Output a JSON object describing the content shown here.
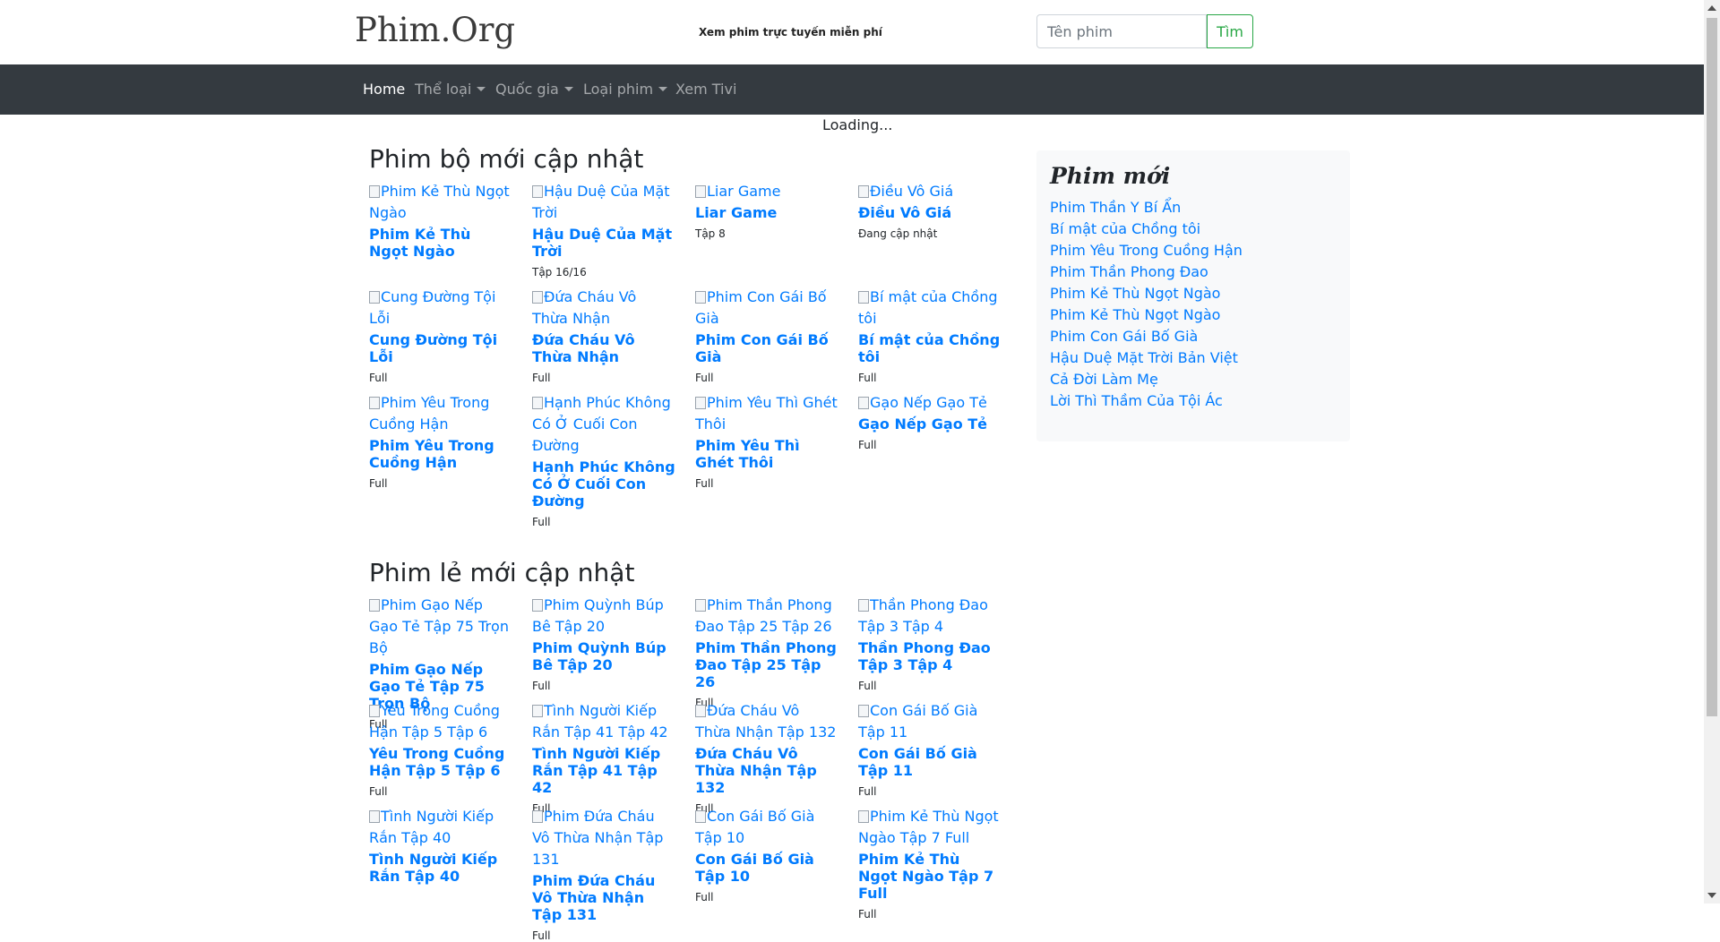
{
  "header": {
    "logo": "Phim.Org",
    "tagline": "Xem phim trực tuyến miễn phí",
    "search_placeholder": "Tên phim",
    "search_button": "Tìm"
  },
  "nav": {
    "home": "Home",
    "genres": "Thể loại",
    "countries": "Quốc gia",
    "types": "Loại phim",
    "tv": "Xem Tivi"
  },
  "loading": "Loading...",
  "series_section": {
    "title": "Phim bộ mới cập nhật",
    "items": [
      {
        "alt": "Phim Kẻ Thù Ngọt Ngào",
        "title": "Phim Kẻ Thù Ngọt Ngào",
        "status": ""
      },
      {
        "alt": "Hậu Duệ Của Mặt Trời",
        "title": "Hậu Duệ Của Mặt Trời",
        "status": "Tập 16/16"
      },
      {
        "alt": "Liar Game",
        "title": "Liar Game",
        "status": "Tập 8"
      },
      {
        "alt": "Điều Vô Giá",
        "title": "Điều Vô Giá",
        "status": "Đang cập nhật"
      },
      {
        "alt": "Cung Đường Tội Lỗi",
        "title": "Cung Đường Tội Lỗi",
        "status": "Full"
      },
      {
        "alt": "Đứa Cháu Vô Thừa Nhận",
        "title": "Đứa Cháu Vô Thừa Nhận",
        "status": "Full"
      },
      {
        "alt": "Phim Con Gái Bố Già",
        "title": "Phim Con Gái Bố Già",
        "status": "Full"
      },
      {
        "alt": "Bí mật của Chồng tôi",
        "title": "Bí mật của Chồng tôi",
        "status": "Full"
      },
      {
        "alt": "Phim Yêu Trong Cuồng Hận",
        "title": "Phim Yêu Trong Cuồng Hận",
        "status": "Full"
      },
      {
        "alt": "Hạnh Phúc Không Có Ở Cuối Con Đường",
        "title": "Hạnh Phúc Không Có Ở Cuối Con Đường",
        "status": "Full"
      },
      {
        "alt": "Phim Yêu Thì Ghét Thôi",
        "title": "Phim Yêu Thì Ghét Thôi",
        "status": "Full"
      },
      {
        "alt": "Gạo Nếp Gạo Tẻ",
        "title": "Gạo Nếp Gạo Tẻ",
        "status": "Full"
      }
    ]
  },
  "movies_section": {
    "title": "Phim lẻ mới cập nhật",
    "items": [
      {
        "alt": "Phim Gạo Nếp Gạo Tẻ Tập 75 Trọn Bộ",
        "title": "Phim Gạo Nếp Gạo Tẻ Tập 75 Trọn Bộ",
        "status": "Full"
      },
      {
        "alt": "Phim Quỳnh Búp Bê Tập 20",
        "title": "Phim Quỳnh Búp Bê Tập 20",
        "status": "Full"
      },
      {
        "alt": "Phim Thần Phong Đao Tập 25 Tập 26",
        "title": "Phim Thần Phong Đao Tập 25 Tập 26",
        "status": "Full"
      },
      {
        "alt": "Thần Phong Đao Tập 3 Tập 4",
        "title": "Thần Phong Đao Tập 3 Tập 4",
        "status": "Full"
      },
      {
        "alt": "Yêu Trong Cuồng Hận Tập 5 Tập 6",
        "title": "Yêu Trong Cuồng Hận Tập 5 Tập 6",
        "status": "Full"
      },
      {
        "alt": "Tình Người Kiếp Rắn Tập 41 Tập 42",
        "title": "Tình Người Kiếp Rắn Tập 41 Tập 42",
        "status": "Full"
      },
      {
        "alt": "Đứa Cháu Vô Thừa Nhận Tập 132",
        "title": "Đứa Cháu Vô Thừa Nhận Tập 132",
        "status": "Full"
      },
      {
        "alt": "Con Gái Bố Già Tập 11",
        "title": "Con Gái Bố Già Tập 11",
        "status": "Full"
      },
      {
        "alt": "Tình Người Kiếp Rắn Tập 40",
        "title": "Tình Người Kiếp Rắn Tập 40",
        "status": ""
      },
      {
        "alt": "Phim Đứa Cháu Vô Thừa Nhận Tập 131",
        "title": "Phim Đứa Cháu Vô Thừa Nhận Tập 131",
        "status": "Full"
      },
      {
        "alt": "Con Gái Bố Già Tập 10",
        "title": "Con Gái Bố Già Tập 10",
        "status": "Full"
      },
      {
        "alt": "Phim Kẻ Thù Ngọt Ngào Tập 7 Full",
        "title": "Phim Kẻ Thù Ngọt Ngào Tập 7 Full",
        "status": "Full"
      }
    ]
  },
  "sidebar": {
    "title": "Phim mới",
    "links": [
      "Phim Thần Y Bí Ẩn",
      "Bí mật của Chồng tôi",
      "Phim Yêu Trong Cuồng Hận",
      "Phim Thần Phong Đao",
      "Phim Kẻ Thù Ngọt Ngào",
      "Phim Kẻ Thù Ngọt Ngào",
      "Phim Con Gái Bố Già",
      "Hậu Duệ Mặt Trời Bản Việt",
      "Cả Đời Làm Mẹ",
      "Lời Thì Thầm Của Tội Ác"
    ]
  },
  "colors": {
    "link": "#007bff",
    "navbar_bg": "#343a40",
    "search_button": "#28a745",
    "sidebar_bg": "#f8f9fa"
  }
}
